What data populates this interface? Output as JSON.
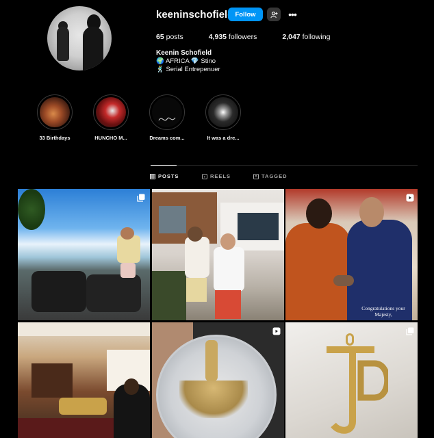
{
  "profile": {
    "username": "keeninschofield",
    "follow_label": "Follow",
    "stats": {
      "posts_count": "65",
      "posts_label": "posts",
      "followers_count": "4,935",
      "followers_label": "followers",
      "following_count": "2,047",
      "following_label": "following"
    },
    "full_name": "Keenin Schofield",
    "bio_line1": "🌍 AFRICA 💎 Stino",
    "bio_line2": "🕺 Serial Entrepenuer"
  },
  "highlights": [
    {
      "label": "33 Birthdays",
      "icon": "cake-photo"
    },
    {
      "label": "HUNCHO M...",
      "icon": "logo-photo"
    },
    {
      "label": "Dreams com...",
      "icon": "signature-photo"
    },
    {
      "label": "It was a dre...",
      "icon": "car-photo"
    }
  ],
  "tabs": [
    {
      "label": "POSTS",
      "icon": "grid-icon",
      "active": true
    },
    {
      "label": "REELS",
      "icon": "reels-icon",
      "active": false
    },
    {
      "label": "TAGGED",
      "icon": "tag-icon",
      "active": false
    }
  ],
  "posts": [
    {
      "subject": "beach scooters",
      "badge": "carousel-icon"
    },
    {
      "subject": "two men in front of house",
      "badge": ""
    },
    {
      "subject": "handshake",
      "badge": "reel-icon",
      "caption": "Congratulations your Majesty,"
    },
    {
      "subject": "living room with men",
      "badge": ""
    },
    {
      "subject": "silver medallion",
      "badge": "reel-icon"
    },
    {
      "subject": "gold JP pendant",
      "badge": "carousel-icon"
    }
  ],
  "colors": {
    "accent": "#0095f6",
    "background": "#000000",
    "secondary_button": "#363636"
  }
}
